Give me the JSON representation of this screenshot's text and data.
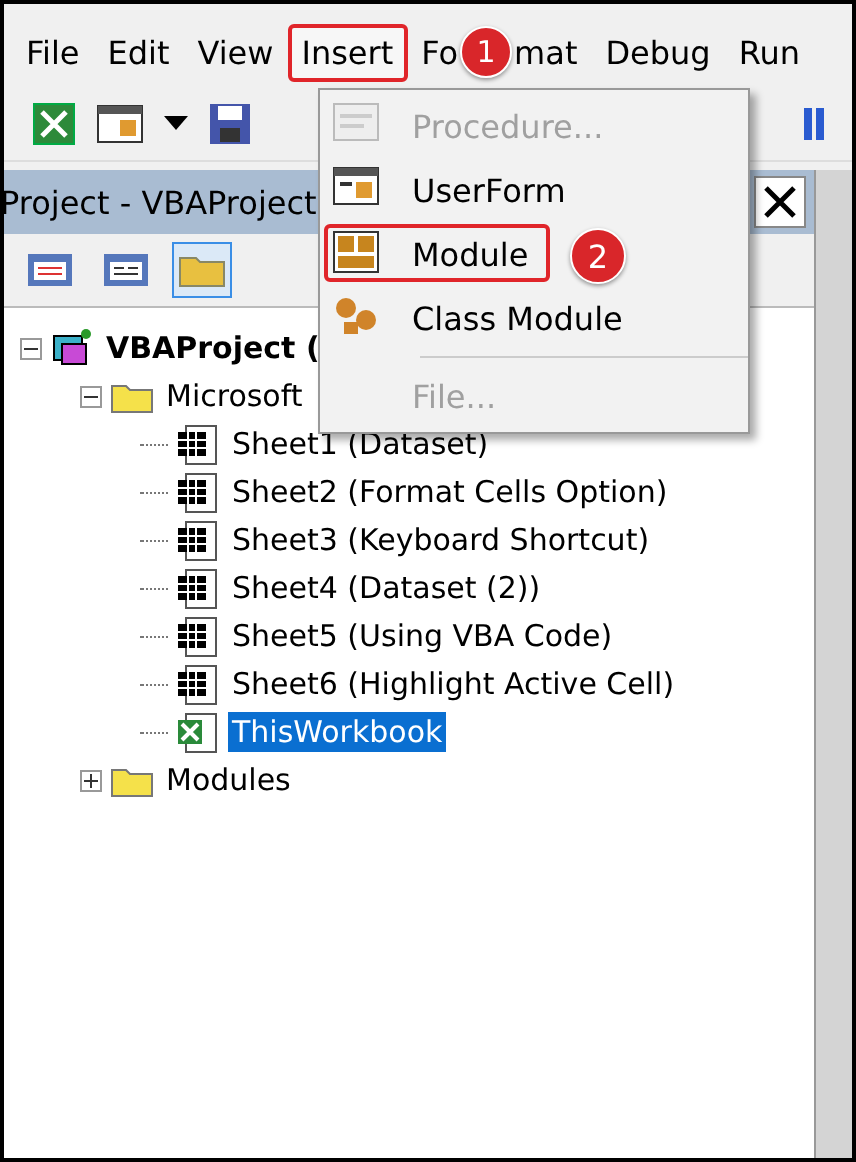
{
  "menu_bar": [
    {
      "label": "File",
      "open": false
    },
    {
      "label": "Edit",
      "open": false
    },
    {
      "label": "View",
      "open": false
    },
    {
      "label": "Insert",
      "open": true
    },
    {
      "label": "Fo",
      "open": false,
      "badge": "1"
    },
    {
      "label": "mat",
      "open": false
    },
    {
      "label": "Debug",
      "open": false
    },
    {
      "label": "Run",
      "open": false
    }
  ],
  "dropdown": [
    {
      "label": "Procedure...",
      "kind": "procedure",
      "disabled": true,
      "highlighted": false
    },
    {
      "label": "UserForm",
      "kind": "userform",
      "disabled": false,
      "highlighted": false
    },
    {
      "label": "Module",
      "kind": "module",
      "disabled": false,
      "highlighted": true,
      "badge": "2"
    },
    {
      "label": "Class Module",
      "kind": "class",
      "disabled": false,
      "highlighted": false
    },
    {
      "label": "File...",
      "kind": "plain",
      "disabled": true,
      "highlighted": false,
      "separator_before": true
    }
  ],
  "project_panel": {
    "title": "Project - VBAProject"
  },
  "tree": [
    {
      "label": "VBAProject (",
      "kind": "project",
      "expanded": true,
      "selected": false,
      "children": [
        {
          "label": "Microsoft",
          "kind": "folder",
          "expanded": true,
          "selected": false,
          "children": [
            {
              "label": "Sheet1 (Dataset)",
              "kind": "sheet",
              "selected": false
            },
            {
              "label": "Sheet2 (Format Cells Option)",
              "kind": "sheet",
              "selected": false
            },
            {
              "label": "Sheet3 (Keyboard Shortcut)",
              "kind": "sheet",
              "selected": false
            },
            {
              "label": "Sheet4 (Dataset (2))",
              "kind": "sheet",
              "selected": false
            },
            {
              "label": "Sheet5 (Using VBA Code)",
              "kind": "sheet",
              "selected": false
            },
            {
              "label": "Sheet6 (Highlight Active Cell)",
              "kind": "sheet",
              "selected": false
            },
            {
              "label": "ThisWorkbook",
              "kind": "workbook",
              "selected": true
            }
          ]
        },
        {
          "label": "Modules",
          "kind": "folder",
          "expanded": false,
          "selected": false
        }
      ]
    }
  ]
}
